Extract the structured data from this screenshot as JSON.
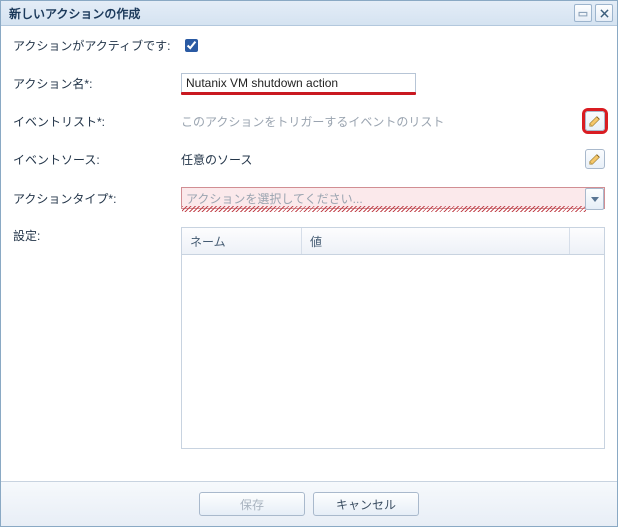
{
  "window": {
    "title": "新しいアクションの作成"
  },
  "form": {
    "active_label": "アクションがアクティブです:",
    "active_checked": true,
    "name_label": "アクション名*:",
    "name_value": "Nutanix VM shutdown action",
    "eventlist_label": "イベントリスト*:",
    "eventlist_placeholder": "このアクションをトリガーするイベントのリスト",
    "eventsource_label": "イベントソース:",
    "eventsource_value": "任意のソース",
    "actiontype_label": "アクションタイプ*:",
    "actiontype_placeholder": "アクションを選択してください...",
    "settings_label": "設定:"
  },
  "grid": {
    "col_name": "ネーム",
    "col_value": "値"
  },
  "buttons": {
    "save": "保存",
    "cancel": "キャンセル"
  }
}
